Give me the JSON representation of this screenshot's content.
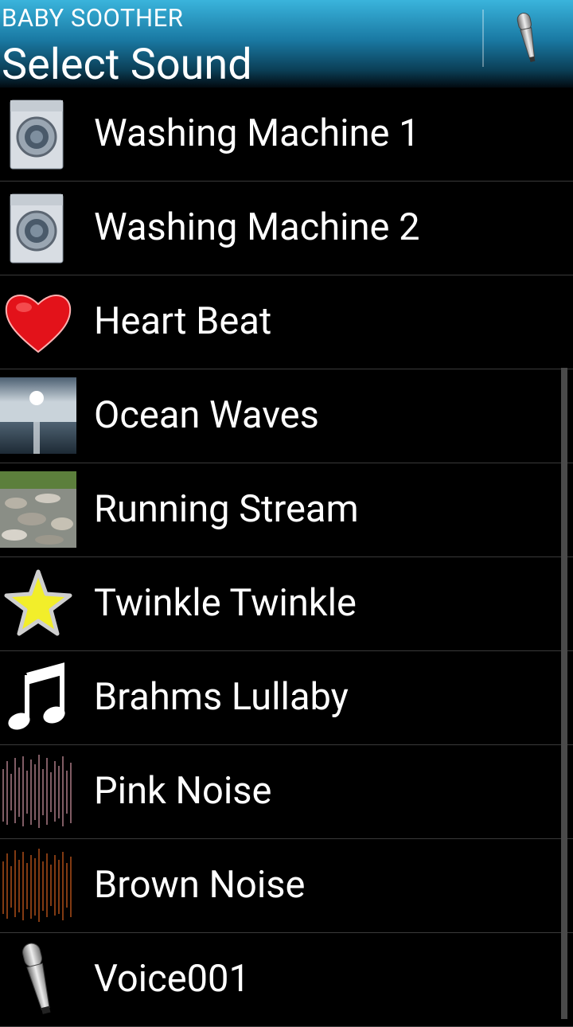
{
  "actionbar": {
    "app_name": "BABY SOOTHER",
    "title": "Select Sound",
    "mic_icon": "microphone-icon"
  },
  "sounds": [
    {
      "label": "Washing Machine 1",
      "icon": "washing-machine-icon"
    },
    {
      "label": "Washing Machine 2",
      "icon": "washing-machine-icon"
    },
    {
      "label": "Heart Beat",
      "icon": "heart-icon"
    },
    {
      "label": "Ocean Waves",
      "icon": "ocean-photo"
    },
    {
      "label": "Running Stream",
      "icon": "stream-photo"
    },
    {
      "label": "Twinkle Twinkle",
      "icon": "star-icon"
    },
    {
      "label": "Brahms Lullaby",
      "icon": "music-note-icon"
    },
    {
      "label": "Pink Noise",
      "icon": "pink-noise-icon"
    },
    {
      "label": "Brown Noise",
      "icon": "brown-noise-icon"
    },
    {
      "label": "Voice001",
      "icon": "microphone-icon"
    }
  ],
  "colors": {
    "actionbar_top": "#3ab4dc",
    "actionbar_bottom": "#020a10",
    "background": "#000000",
    "divider": "#3a3a3a"
  }
}
